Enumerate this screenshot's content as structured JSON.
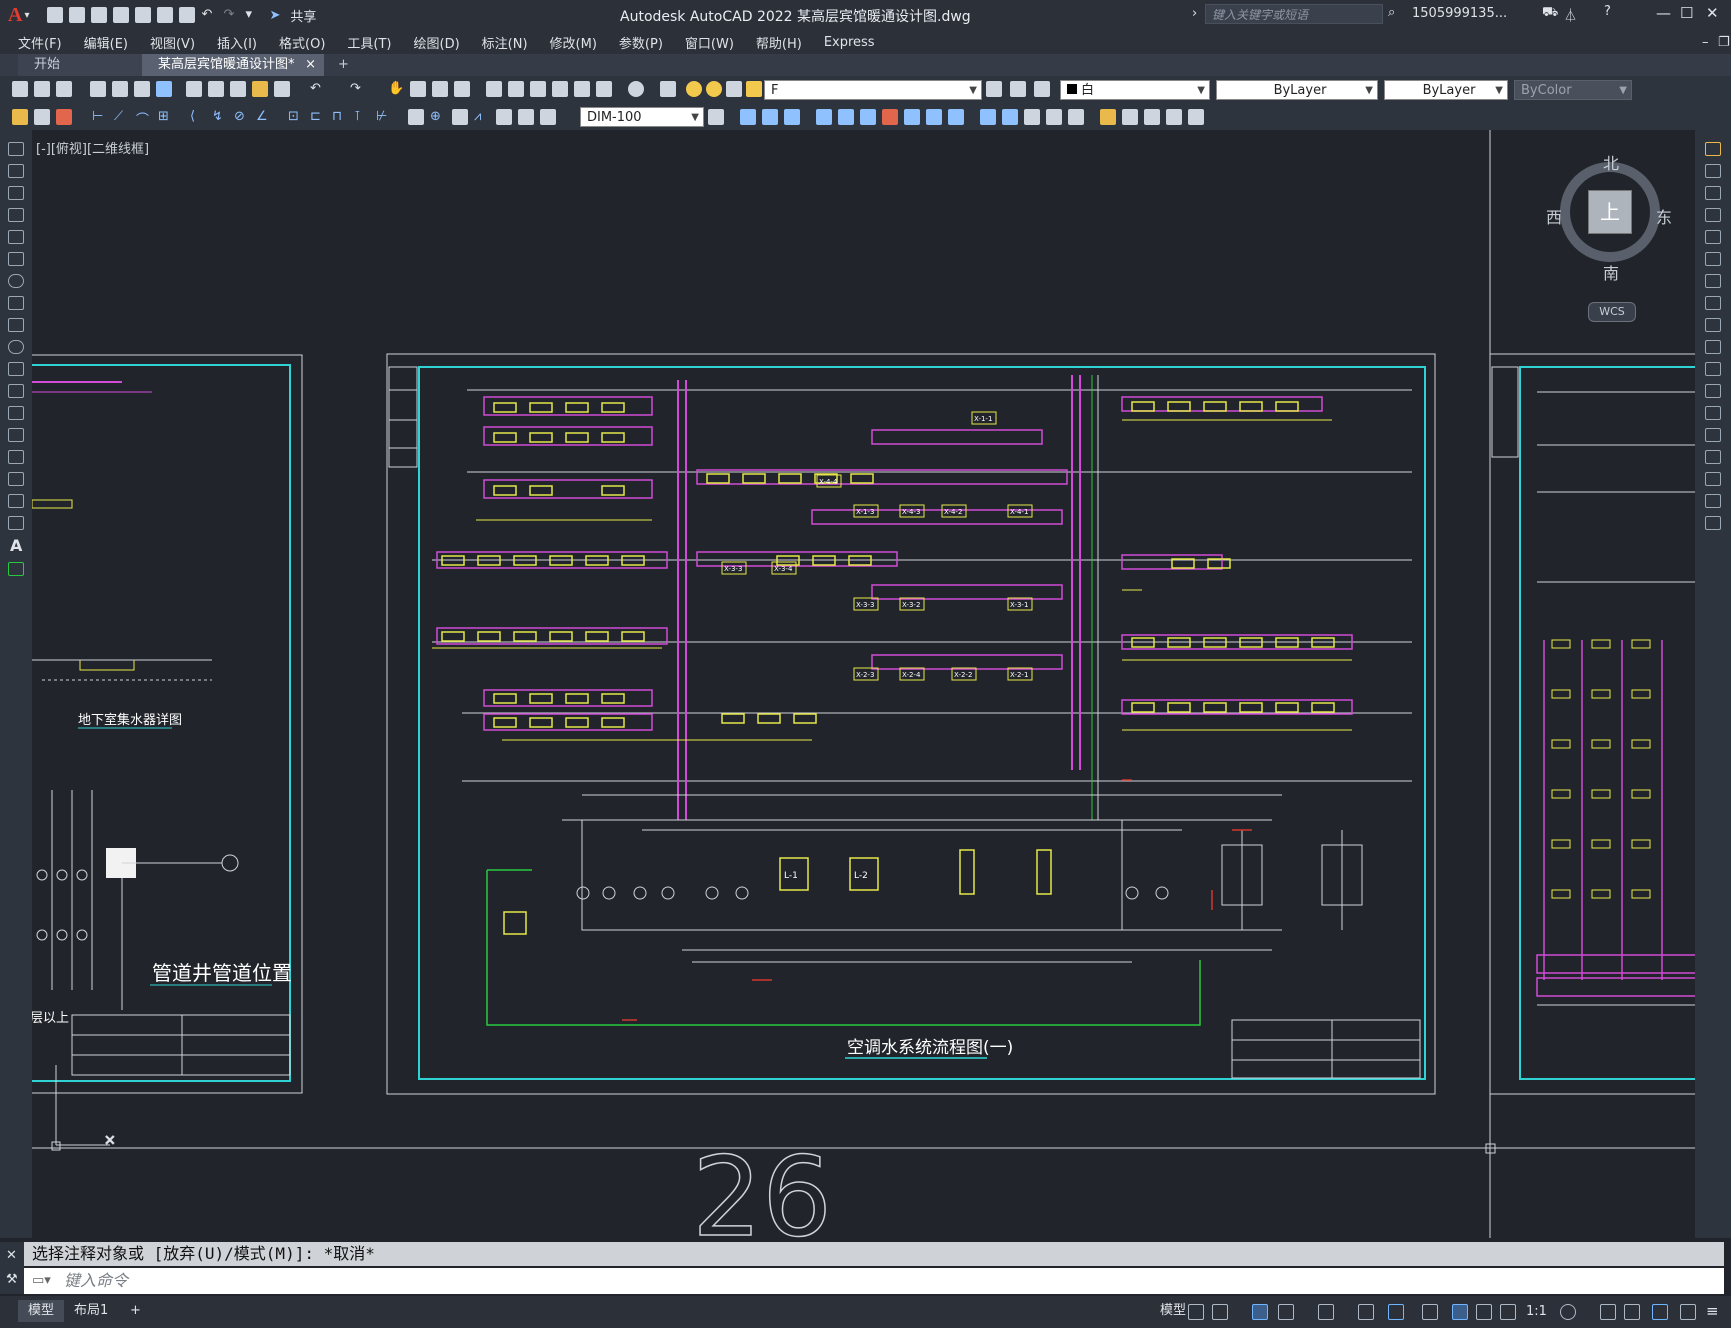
{
  "app": {
    "logo": "A",
    "title": "Autodesk AutoCAD 2022    某高层宾馆暖通设计图.dwg",
    "share_label": "共享",
    "search_placeholder": "键入关键字或短语",
    "user": "1505999135...",
    "window_controls": [
      "minimize-icon",
      "restore-icon",
      "close-icon"
    ]
  },
  "menu": [
    "文件(F)",
    "编辑(E)",
    "视图(V)",
    "插入(I)",
    "格式(O)",
    "工具(T)",
    "绘图(D)",
    "标注(N)",
    "修改(M)",
    "参数(P)",
    "窗口(W)",
    "帮助(H)",
    "Express"
  ],
  "tabs": [
    {
      "label": "开始"
    },
    {
      "label": "某高层宾馆暖通设计图*",
      "close": "×"
    },
    {
      "label": "+"
    }
  ],
  "ribbon": {
    "layer_value": "F",
    "color_value": "白",
    "linetype_value": "ByLayer",
    "lineweight_value": "ByLayer",
    "plotstyle_value": "ByColor",
    "dimstyle_value": "DIM-100"
  },
  "viewport": {
    "view_label": "[-][俯视][二维线框]",
    "compass": {
      "north": "北",
      "south": "南",
      "east": "东",
      "west": "西",
      "cube_face": "上",
      "wcs": "WCS"
    }
  },
  "drawing": {
    "main_title": "空调水系统流程图(一)",
    "left_title_1": "地下室集水器详图",
    "left_title_2": "管道井管道位置",
    "left_note": "层以上",
    "pump_labels": [
      "L-1",
      "L-2"
    ],
    "unit_labels": [
      "X-4-4",
      "X-1-3",
      "X-4-3",
      "X-4-2",
      "X-4-1",
      "X-3-3",
      "X-3-4",
      "X-3-3",
      "X-3-2",
      "X-3-1",
      "X-2-3",
      "X-2-4",
      "X-2-2",
      "X-2-1",
      "X-1-1"
    ],
    "grid_number": "26"
  },
  "command": {
    "history": "选择注释对象或 [放弃(U)/模式(M)]: *取消*",
    "input_placeholder": "键入命令"
  },
  "status": {
    "tabs": [
      "模型",
      "布局1",
      "+"
    ],
    "scale": "1:1"
  },
  "colors": {
    "background": "#21252b",
    "magenta": "#d14bd6",
    "yellow": "#e6e64a",
    "cyan": "#2fd3d3",
    "green": "#27c93f",
    "red": "#d2362e"
  }
}
